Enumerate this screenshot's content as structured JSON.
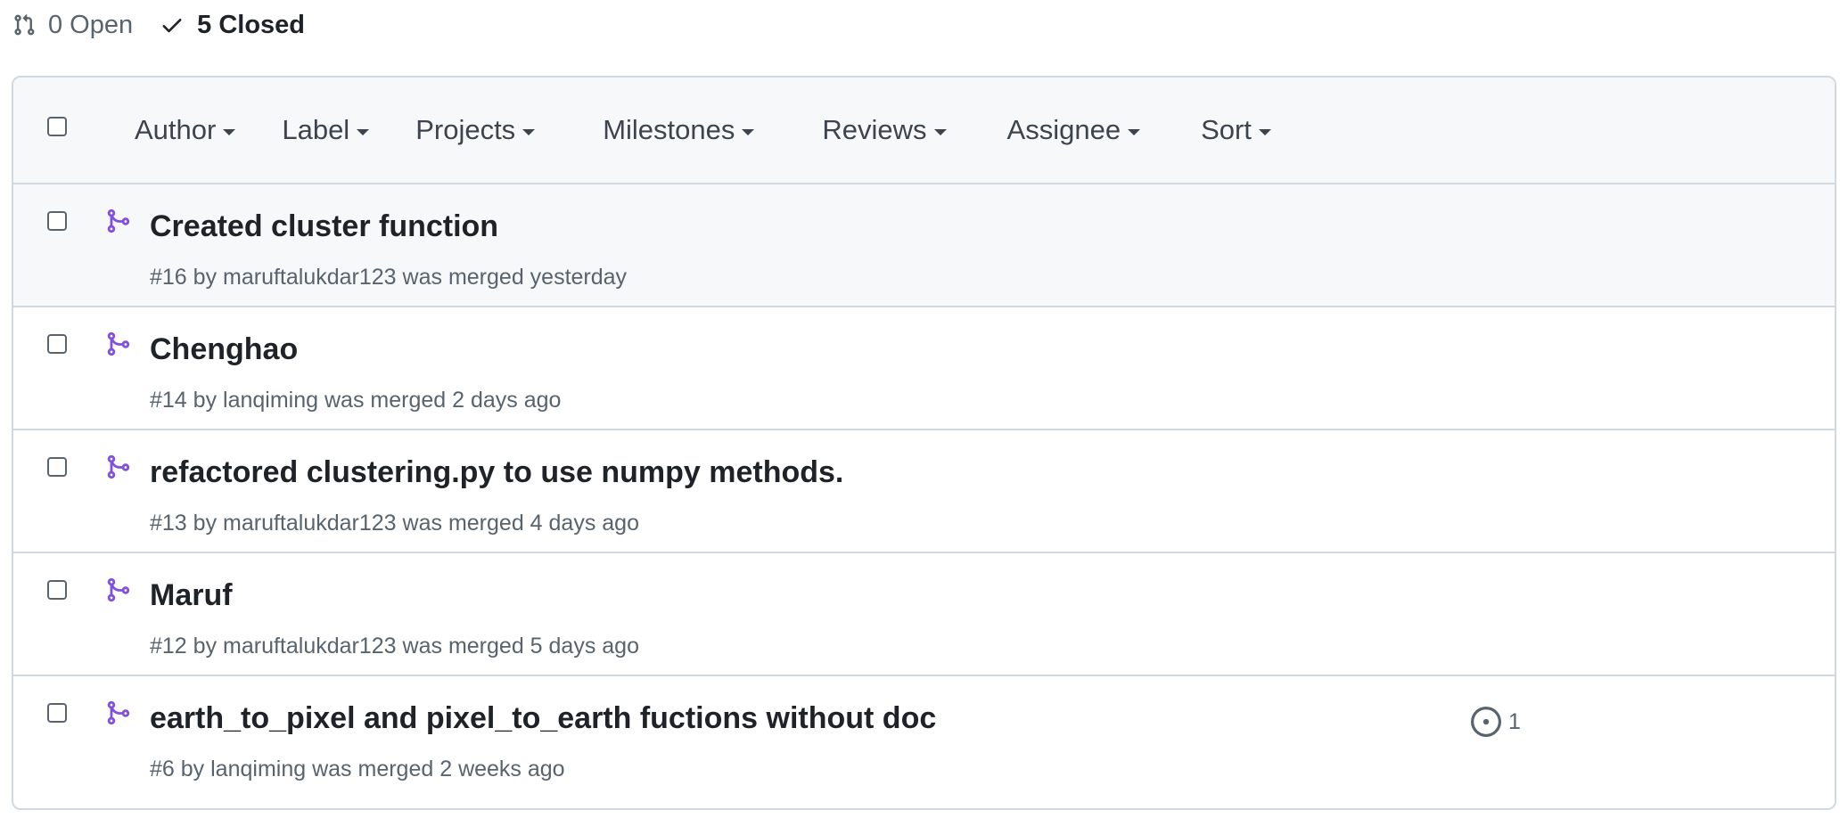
{
  "states": {
    "open_label": "0 Open",
    "closed_label": "5 Closed"
  },
  "filters": [
    "Author",
    "Label",
    "Projects",
    "Milestones",
    "Reviews",
    "Assignee",
    "Sort"
  ],
  "pull_requests": [
    {
      "title": "Created cluster function",
      "number": "#16",
      "by": "by",
      "author": "maruftalukdar123",
      "status": "was merged",
      "time": "yesterday",
      "highlighted": true
    },
    {
      "title": "Chenghao",
      "number": "#14",
      "by": "by",
      "author": "lanqiming",
      "status": "was merged",
      "time": "2 days ago"
    },
    {
      "title": "refactored clustering.py to use numpy methods.",
      "number": "#13",
      "by": "by",
      "author": "maruftalukdar123",
      "status": "was merged",
      "time": "4 days ago"
    },
    {
      "title": "Maruf",
      "number": "#12",
      "by": "by",
      "author": "maruftalukdar123",
      "status": "was merged",
      "time": "5 days ago"
    },
    {
      "title": "earth_to_pixel and pixel_to_earth fuctions without doc",
      "number": "#6",
      "by": "by",
      "author": "lanqiming",
      "status": "was merged",
      "time": "2 weeks ago",
      "linked_issues": "1"
    }
  ],
  "colors": {
    "merged_icon": "#8250df",
    "border": "#d1d9e0",
    "header_bg": "#f6f8fa",
    "muted_text": "#59636e",
    "primary_text": "#1f2328"
  },
  "icons": {
    "open_state": "git-pull-request-icon",
    "closed_state": "check-icon",
    "merged": "git-merge-icon",
    "linked_issue": "issue-opened-icon"
  }
}
